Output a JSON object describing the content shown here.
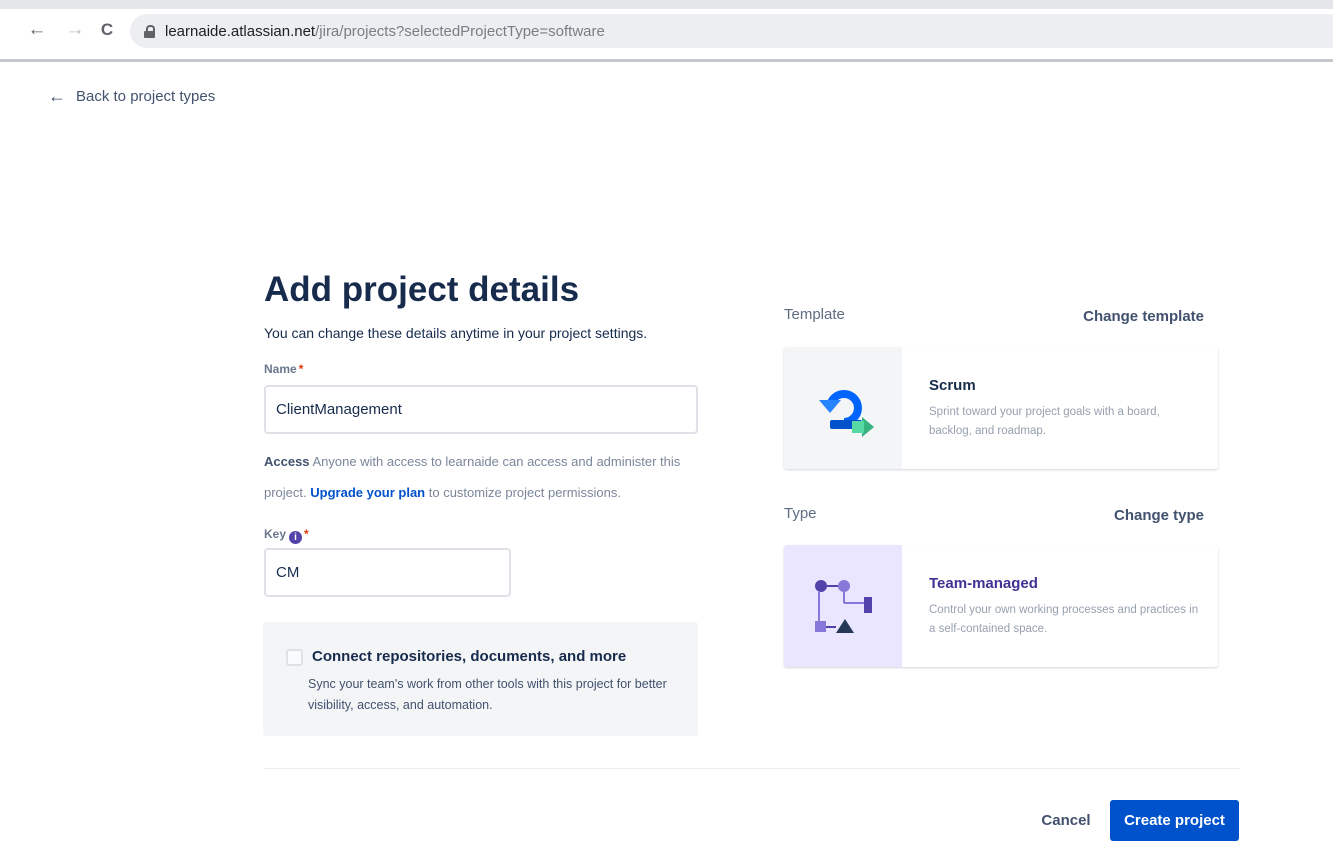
{
  "browser": {
    "url_host": "learnaide.atlassian.net",
    "url_path": "/jira/projects?selectedProjectType=software",
    "back_glyph": "←",
    "forward_glyph": "→",
    "reload_glyph": "C"
  },
  "nav": {
    "back_label": "Back to project types",
    "back_icon": "arrow-left-icon"
  },
  "form": {
    "title": "Add project details",
    "subtitle": "You can change these details anytime in your project settings.",
    "name_label": "Name",
    "name_value": "ClientManagement",
    "required_mark": "*",
    "access_label": "Access",
    "access_text_1": "Anyone with access to learnaide can access and administer this project.",
    "access_link": "Upgrade your plan",
    "access_text_2": "to customize project permissions.",
    "key_label": "Key",
    "key_info_icon": "info-icon",
    "key_value": "CM",
    "connect": {
      "checked": false,
      "title": "Connect repositories, documents, and more",
      "description": "Sync your team's work from other tools with this project for better visibility, access, and automation."
    }
  },
  "template": {
    "section_label": "Template",
    "change_label": "Change template",
    "name": "Scrum",
    "description": "Sprint toward your project goals with a board, backlog, and roadmap.",
    "icon": "scrum-cycle-icon"
  },
  "type": {
    "section_label": "Type",
    "change_label": "Change type",
    "name": "Team-managed",
    "description": "Control your own working processes and practices in a self-contained space.",
    "icon": "team-managed-icon"
  },
  "footer": {
    "cancel_label": "Cancel",
    "create_label": "Create project"
  },
  "colors": {
    "primary": "#0052cc",
    "text": "#172b4d",
    "required": "#de350b",
    "type_accent": "#5243aa",
    "scrum_accent": "#36b37e"
  }
}
